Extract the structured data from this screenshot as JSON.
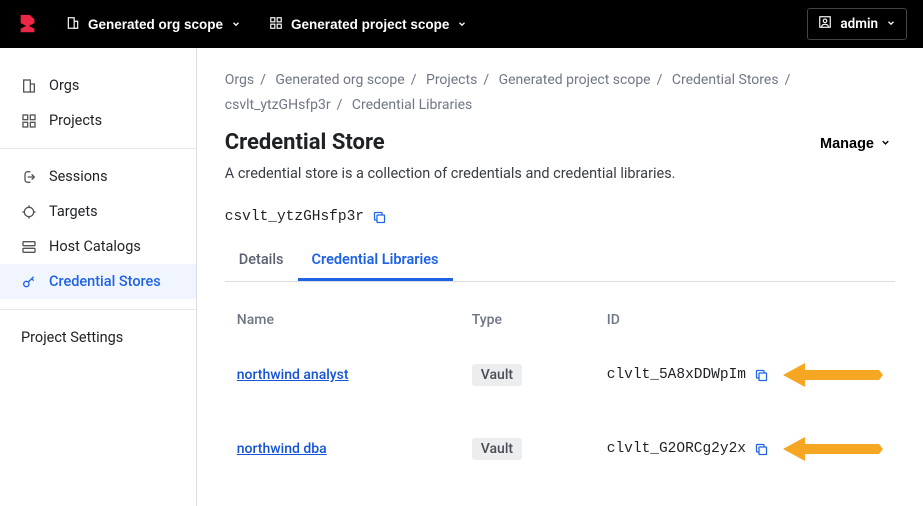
{
  "topbar": {
    "org_scope": "Generated org scope",
    "project_scope": "Generated project scope",
    "user": "admin"
  },
  "sidebar": {
    "orgs": "Orgs",
    "projects": "Projects",
    "sessions": "Sessions",
    "targets": "Targets",
    "host_catalogs": "Host Catalogs",
    "credential_stores": "Credential Stores",
    "project_settings": "Project Settings"
  },
  "breadcrumb": {
    "c0": "Orgs",
    "c1": "Generated org scope",
    "c2": "Projects",
    "c3": "Generated project scope",
    "c4": "Credential Stores",
    "c5": "csvlt_ytzGHsfp3r",
    "c6": "Credential Libraries"
  },
  "page": {
    "title": "Credential Store",
    "subtitle": "A credential store is a collection of credentials and credential libraries.",
    "manage_label": "Manage",
    "store_id": "csvlt_ytzGHsfp3r"
  },
  "tabs": {
    "details": "Details",
    "cred_libs": "Credential Libraries"
  },
  "table": {
    "head_name": "Name",
    "head_type": "Type",
    "head_id": "ID",
    "rows": [
      {
        "name": "northwind analyst",
        "type": "Vault",
        "id": "clvlt_5A8xDDWpIm"
      },
      {
        "name": "northwind dba",
        "type": "Vault",
        "id": "clvlt_G2ORCg2y2x"
      }
    ]
  }
}
